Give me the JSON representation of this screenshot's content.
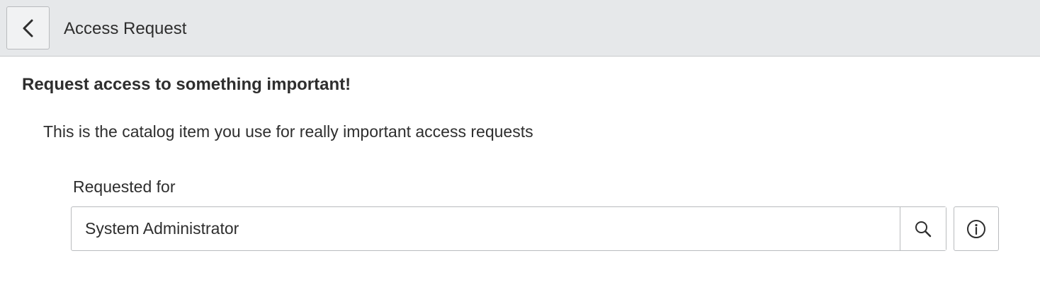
{
  "header": {
    "back_icon": "chevron-left-icon",
    "title": "Access Request"
  },
  "main": {
    "section_title": "Request access to something important!",
    "description": "This is the catalog item you use for really important access requests",
    "requested_for": {
      "label": "Requested for",
      "value": "System Administrator",
      "lookup_icon": "search-icon",
      "info_icon": "info-icon"
    }
  },
  "colors": {
    "header_bg": "#e6e8ea",
    "border": "#b9bbbe",
    "text": "#2e2e2e"
  }
}
